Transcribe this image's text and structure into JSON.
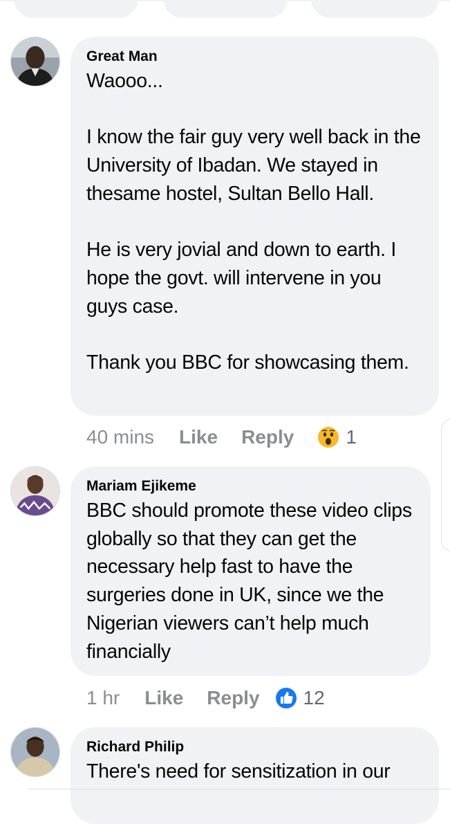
{
  "colors": {
    "bubble": "#f0f2f5",
    "meta_text": "#8a8d91",
    "like_blue": "#1877f2",
    "wow_yellow": "#f7b928"
  },
  "comments": [
    {
      "author": "Great Man",
      "text": "Waooo...\n\nI know the fair guy very well back in the University of Ibadan. We stayed in thesame hostel, Sultan Bello Hall.\n\nHe is very jovial and down to earth. I hope the govt. will intervene in you guys case.\n\nThank you BBC for showcasing them.",
      "time": "40 mins",
      "like_label": "Like",
      "reply_label": "Reply",
      "reaction_icon": "wow-reaction-icon",
      "reaction_count": "1"
    },
    {
      "author": "Mariam Ejikeme",
      "text": "BBC should promote these video clips globally so that they can get the necessary help fast to have the surgeries done in UK, since we the Nigerian viewers can’t help much financially",
      "time": "1 hr",
      "like_label": "Like",
      "reply_label": "Reply",
      "reaction_icon": "like-reaction-icon",
      "reaction_count": "12"
    },
    {
      "author": "Richard Philip",
      "text": "There's need for sensitization in our"
    }
  ]
}
